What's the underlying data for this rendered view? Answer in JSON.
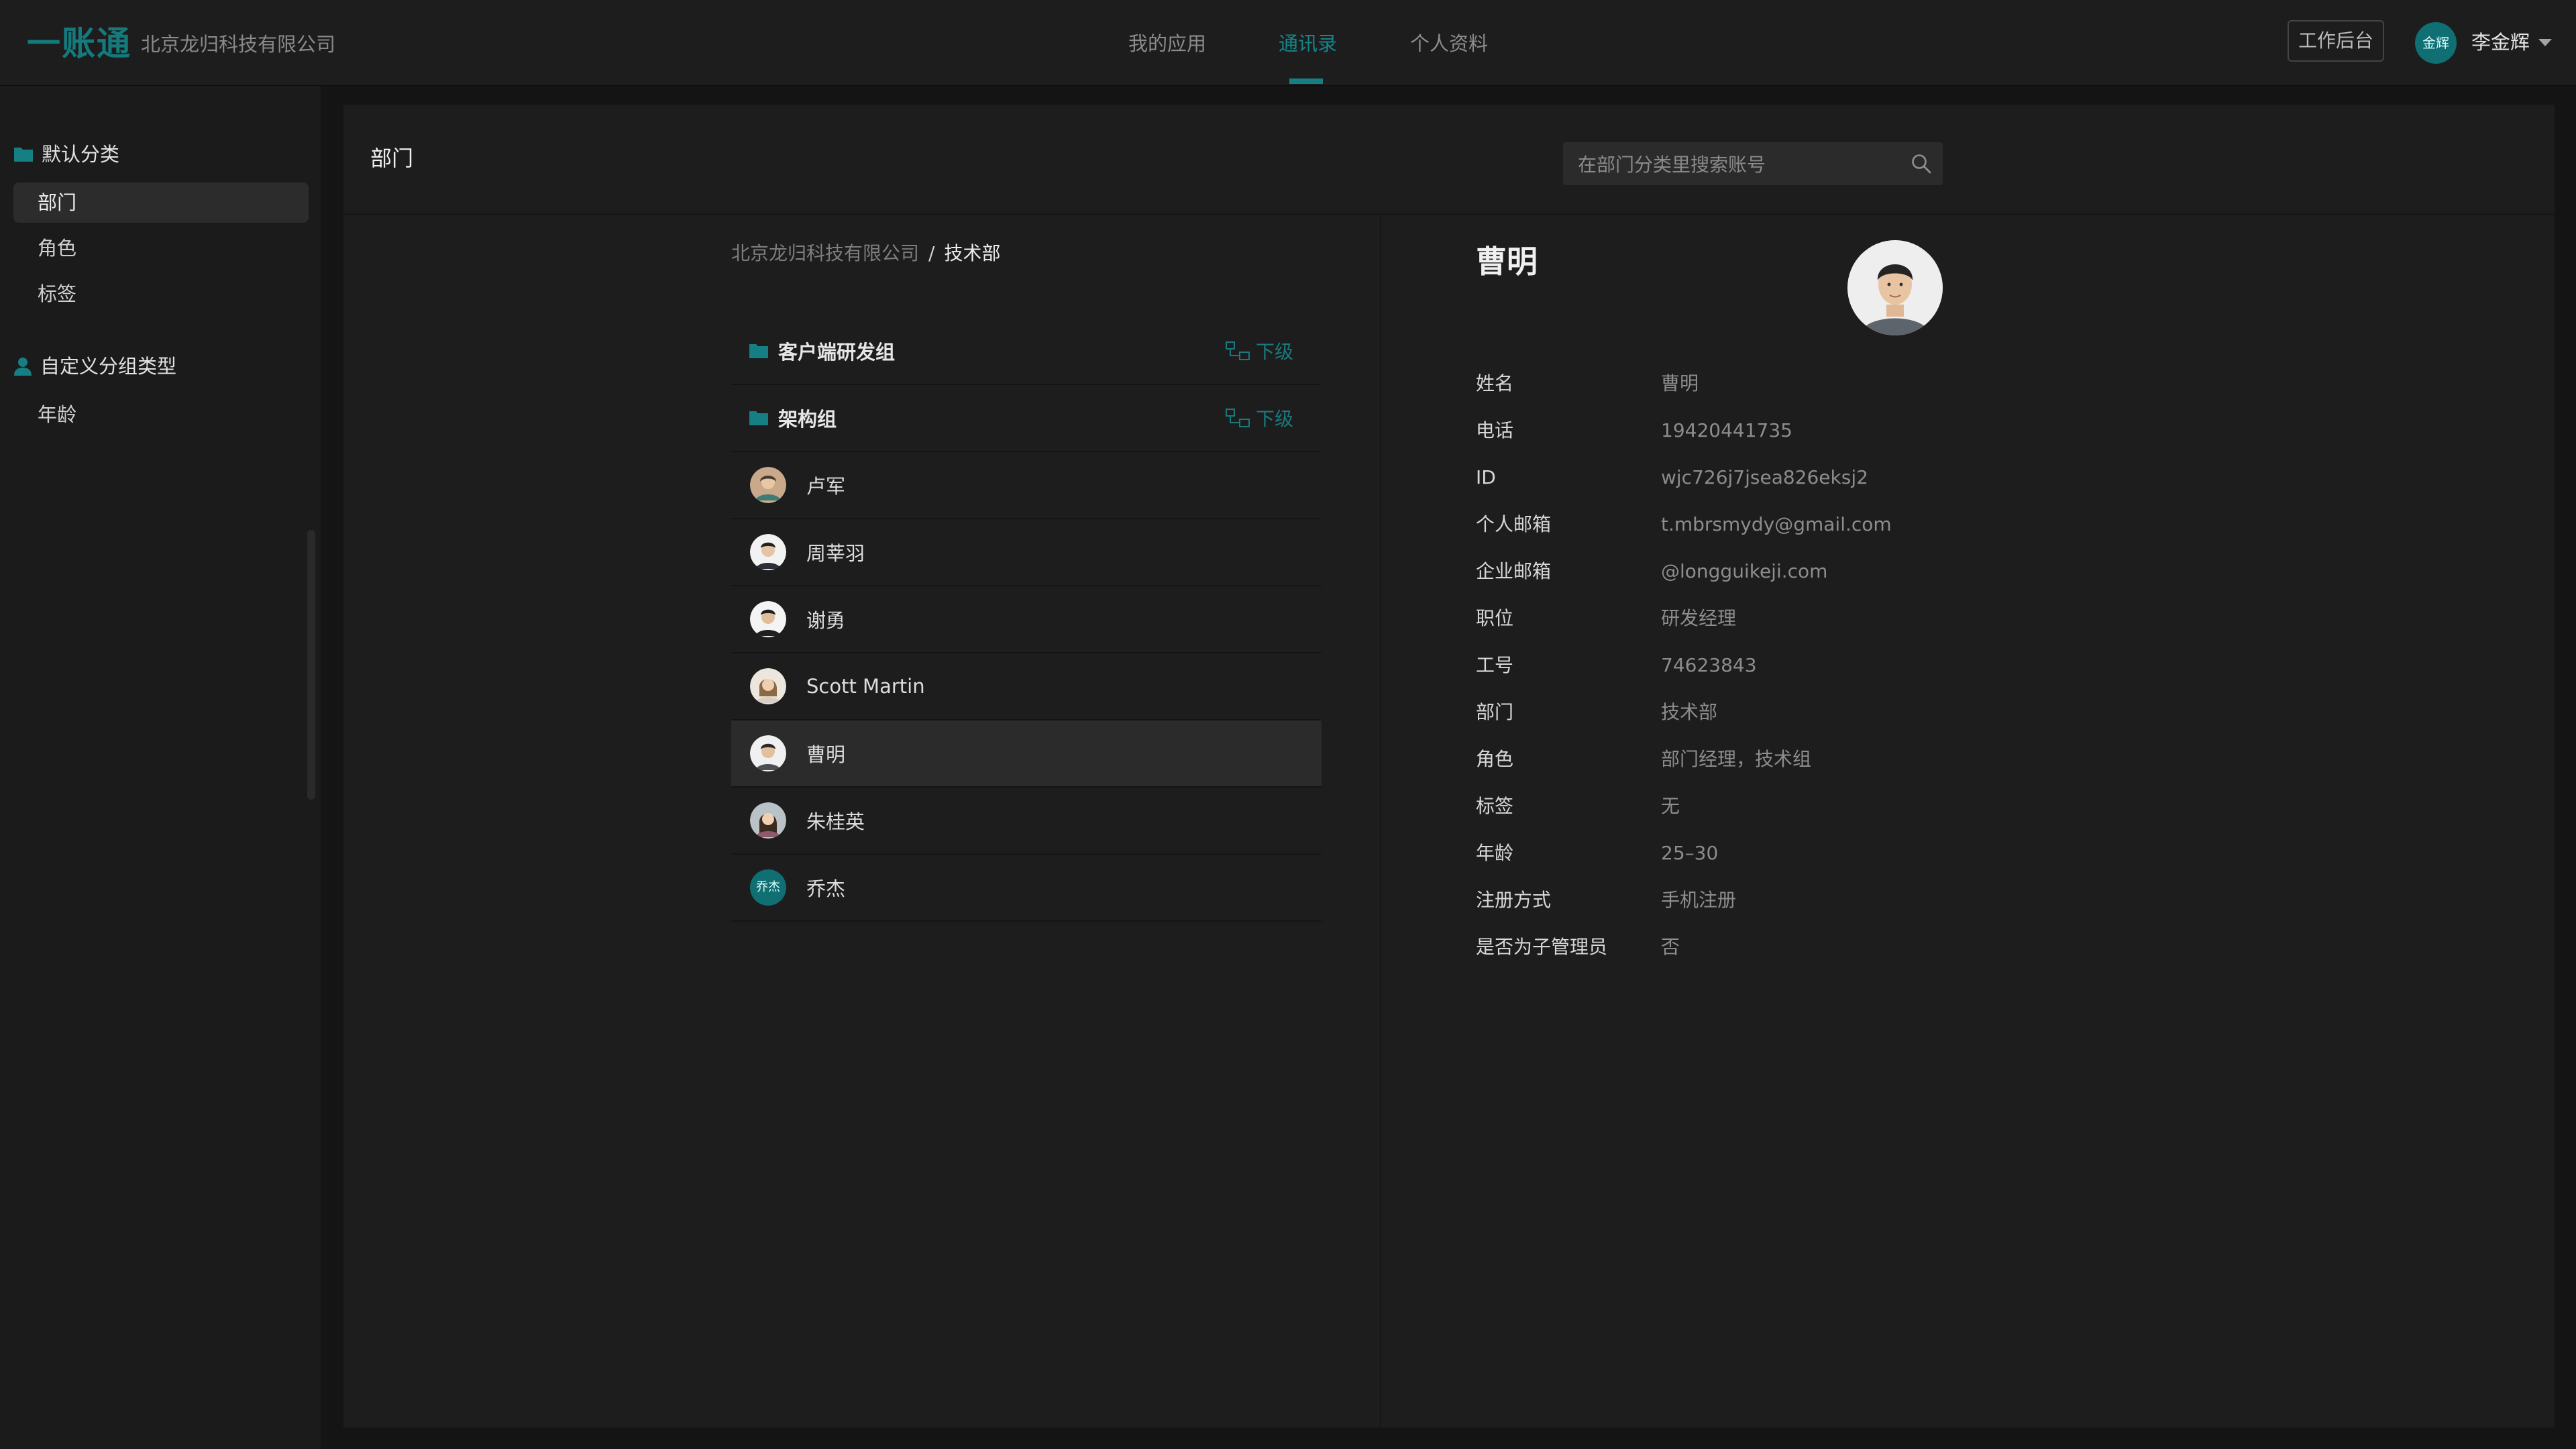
{
  "header": {
    "logo": "一账通",
    "company": "北京龙归科技有限公司",
    "nav": [
      {
        "label": "我的应用"
      },
      {
        "label": "通讯录"
      },
      {
        "label": "个人资料"
      }
    ],
    "active_nav": "通讯录",
    "workbench_label": "工作后台",
    "user_avatar_text": "金辉",
    "user_name": "李金辉"
  },
  "sidebar": {
    "group1": {
      "label": "默认分类",
      "icon": "folder-icon"
    },
    "items": [
      {
        "label": "部门",
        "active": true
      },
      {
        "label": "角色"
      },
      {
        "label": "标签"
      }
    ],
    "group2": {
      "label": "自定义分组类型",
      "icon": "person-icon"
    },
    "group2_items": [
      {
        "label": "年龄"
      }
    ]
  },
  "panel": {
    "title": "部门",
    "search_placeholder": "在部门分类里搜索账号"
  },
  "breadcrumb": {
    "root": "北京龙归科技有限公司",
    "separator": "/",
    "current": "技术部"
  },
  "list": {
    "folders": [
      {
        "label": "客户端研发组",
        "sub_label": "下级"
      },
      {
        "label": "架构组",
        "sub_label": "下级"
      }
    ],
    "members": [
      {
        "name": "卢军"
      },
      {
        "name": "周莘羽"
      },
      {
        "name": "谢勇"
      },
      {
        "name": "Scott Martin"
      },
      {
        "name": "曹明",
        "selected": true
      },
      {
        "name": "朱桂英"
      },
      {
        "name": "乔杰",
        "avatar_text": "乔杰"
      }
    ]
  },
  "detail": {
    "name": "曹明",
    "fields": [
      {
        "label": "姓名",
        "value": "曹明"
      },
      {
        "label": "电话",
        "value": "19420441735"
      },
      {
        "label": "ID",
        "value": "wjc726j7jsea826eksj2"
      },
      {
        "label": "个人邮箱",
        "value": "t.mbrsmydy@gmail.com"
      },
      {
        "label": "企业邮箱",
        "value": " @longguikeji.com"
      },
      {
        "label": "职位",
        "value": "研发经理"
      },
      {
        "label": "工号",
        "value": "74623843"
      },
      {
        "label": "部门",
        "value": "技术部"
      },
      {
        "label": "角色",
        "value": "部门经理，技术组"
      },
      {
        "label": "标签",
        "value": "无"
      },
      {
        "label": "年龄",
        "value": "25–30"
      },
      {
        "label": "注册方式",
        "value": "手机注册"
      },
      {
        "label": "是否为子管理员",
        "value": "否"
      }
    ]
  },
  "colors": {
    "accent": "#15868a",
    "background": "#141414",
    "panel": "#1d1d1d"
  }
}
